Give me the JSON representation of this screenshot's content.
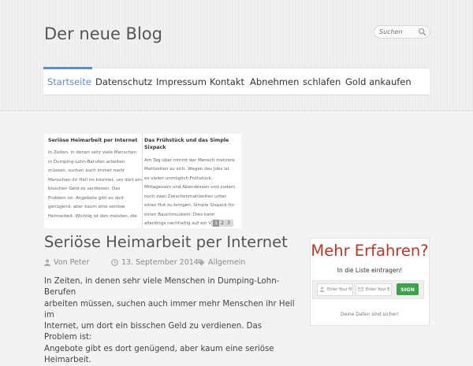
{
  "site": {
    "title": "Der neue Blog"
  },
  "search": {
    "placeholder": "Suchen",
    "icon": "magnifier"
  },
  "nav": {
    "accent": "#5b8fc7",
    "items": [
      {
        "label": "Startseite",
        "active": true
      },
      {
        "label": "Datenschutz"
      },
      {
        "label": "Impressum"
      },
      {
        "label": "Kontakt"
      },
      {
        "label": "Abnehmen"
      },
      {
        "label": "schlafen"
      },
      {
        "label": "Gold ankaufen"
      }
    ]
  },
  "slider": {
    "slides": [
      {
        "title": "Seriöse Heimarbeit per Internet",
        "lines": [
          "In Zeiten, in denen sehr viele Menschen",
          "in Dumping-Lohn-Berufen arbeiten",
          "müssen, suchen auch immer mehr",
          "Menschen ihr Heil im Internet, um dort ein",
          "bisschen Geld zu verdienen. Das",
          "Problem ist: Angebote gibt es dort",
          "genügend, aber kaum eine seriöse",
          "Heimarbeit. Wichtig ist den meisten, die"
        ]
      },
      {
        "title_lines": [
          "Das Frühstück und das Simple",
          "Sixpack"
        ],
        "lines": [
          "Am Tag über nimmt der Mensch mehrere",
          "Mahlzeiten zu sich. Wegen des Jobs ist",
          "es vielen unmöglich Frühstück,",
          "Mittagessen und Abendessen und zudem",
          "noch zwei Zwischenmahlzeiten unter",
          "einen Hut zu bringen. Simple Sixpack für",
          "einen Bauchmuskeln: Dies kann",
          "allerdings nachhaltig auf ein Vorhaben"
        ]
      }
    ],
    "pager": [
      "1",
      "2",
      "3"
    ],
    "active_page": 1
  },
  "post": {
    "title": "Seriöse Heimarbeit per Internet",
    "author_prefix": "Von",
    "author": "Peter",
    "date": "13. September 2014",
    "category": "Allgemein",
    "body_lines": [
      "In Zeiten, in denen sehr viele Menschen in Dumping-Lohn-Berufen",
      "arbeiten müssen, suchen auch immer mehr Menschen ihr Heil im",
      "Internet, um dort ein bisschen Geld zu verdienen. Das Problem ist:",
      "Angebote gibt es dort genügend, aber kaum eine seriöse Heimarbeit."
    ]
  },
  "widget": {
    "title": "Mehr Erfahren?",
    "title_color": "#c8321f",
    "subtitle": "In die Liste eintragen!",
    "name_placeholder": "Enter Your N",
    "email_placeholder": "Enter Your E",
    "button_label": "SIGN",
    "button_color": "#3aa34a",
    "footer": "Deine Daten sind sicher!"
  }
}
